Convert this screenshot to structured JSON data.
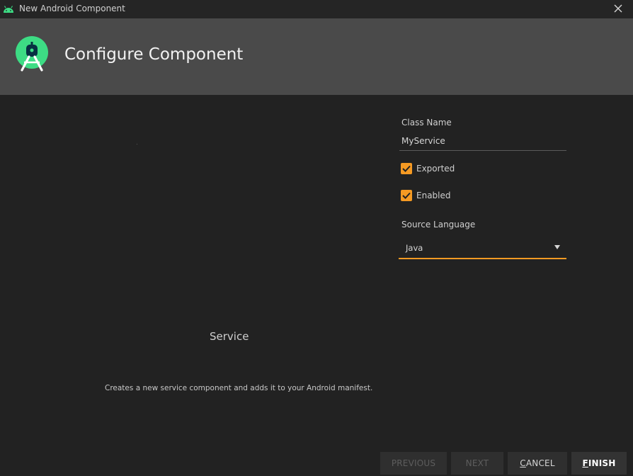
{
  "window": {
    "title": "New Android Component",
    "icon": "android-icon"
  },
  "header": {
    "title": "Configure Component",
    "logo": "android-studio-logo"
  },
  "preview": {
    "title": "Service",
    "description": "Creates a new service component and adds it to your Android manifest."
  },
  "form": {
    "class_name_label": "Class Name",
    "class_name_value": "MyService",
    "exported_label": "Exported",
    "exported_checked": true,
    "enabled_label": "Enabled",
    "enabled_checked": true,
    "source_language_label": "Source Language",
    "source_language_value": "Java"
  },
  "buttons": {
    "previous": {
      "mnemonic": "",
      "rest": "PREVIOUS",
      "enabled": false
    },
    "next": {
      "mnemonic": "",
      "rest": "NEXT",
      "enabled": false
    },
    "cancel": {
      "mnemonic": "C",
      "rest": "ANCEL",
      "enabled": true
    },
    "finish": {
      "mnemonic": "F",
      "rest": "INISH",
      "enabled": true
    }
  },
  "colors": {
    "accent": "#f59a23",
    "header_bg": "#4a4a4a",
    "body_bg": "#222222",
    "android_green": "#3ddc84"
  }
}
